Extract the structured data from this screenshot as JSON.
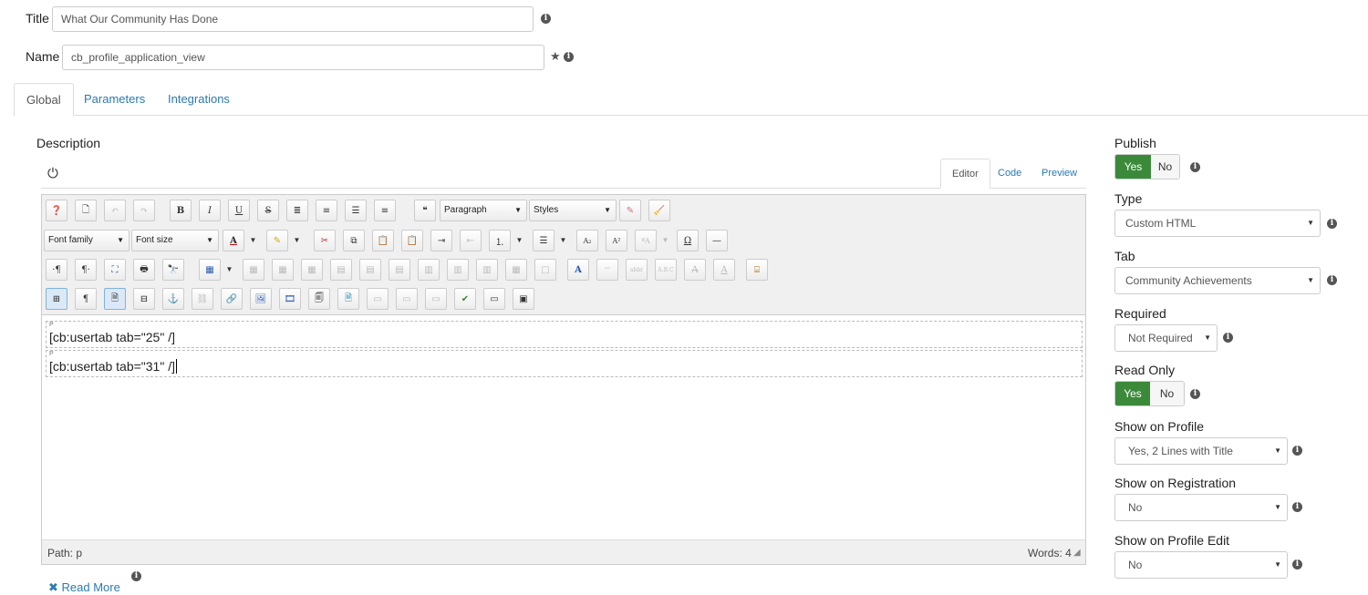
{
  "form": {
    "title_label": "Title",
    "title_value": "What Our Community Has Done",
    "name_label": "Name",
    "name_value": "cb_profile_application_view"
  },
  "tabs": [
    {
      "label": "Global",
      "active": true
    },
    {
      "label": "Parameters",
      "active": false
    },
    {
      "label": "Integrations",
      "active": false
    }
  ],
  "description": {
    "label": "Description",
    "editor_tabs": [
      "Editor",
      "Code",
      "Preview"
    ],
    "toolbar": {
      "format_select": "Paragraph",
      "styles_select": "Styles",
      "font_family_select": "Font family",
      "font_size_select": "Font size"
    },
    "paragraphs": [
      {
        "tag": "P",
        "text": "[cb:usertab tab=\"25\" /]"
      },
      {
        "tag": "P",
        "text": "[cb:usertab tab=\"31\" /]"
      }
    ],
    "path_label": "Path: p",
    "words_label": "Words: 4",
    "read_more_label": "Read More"
  },
  "settings": {
    "publish": {
      "label": "Publish",
      "yes": "Yes",
      "no": "No",
      "value": "Yes"
    },
    "type": {
      "label": "Type",
      "value": "Custom HTML"
    },
    "tab": {
      "label": "Tab",
      "value": "Community Achievements"
    },
    "required": {
      "label": "Required",
      "value": "Not Required"
    },
    "read_only": {
      "label": "Read Only",
      "yes": "Yes",
      "no": "No",
      "value": "Yes"
    },
    "show_on_profile": {
      "label": "Show on Profile",
      "value": "Yes, 2 Lines with Title"
    },
    "show_on_registration": {
      "label": "Show on Registration",
      "value": "No"
    },
    "show_on_profile_edit": {
      "label": "Show on Profile Edit",
      "value": "No"
    }
  },
  "colors": {
    "accent": "#3a8a3a",
    "link": "#2a7ab0",
    "border": "#cccccc"
  }
}
